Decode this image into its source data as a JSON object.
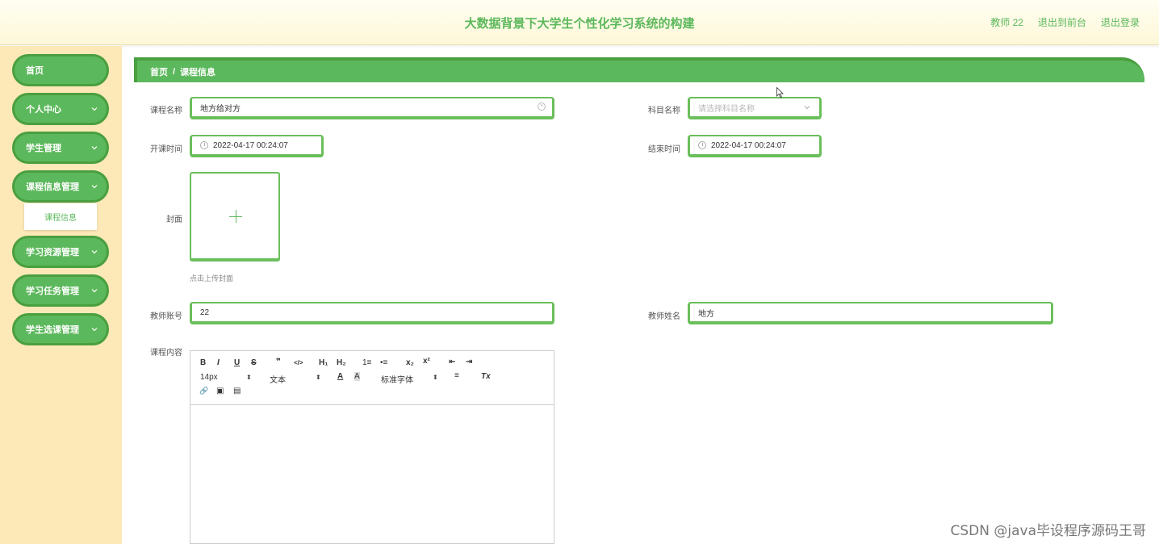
{
  "header": {
    "title": "大数据背景下大学生个性化学习系统的构建",
    "user": "教师 22",
    "back_to_front": "退出到前台",
    "logout": "退出登录"
  },
  "sidebar": {
    "items": [
      {
        "label": "首页",
        "has_children": false
      },
      {
        "label": "个人中心",
        "has_children": true
      },
      {
        "label": "学生管理",
        "has_children": true
      },
      {
        "label": "课程信息管理",
        "has_children": true
      },
      {
        "label": "学习资源管理",
        "has_children": true
      },
      {
        "label": "学习任务管理",
        "has_children": true
      },
      {
        "label": "学生选课管理",
        "has_children": true
      }
    ],
    "submenu_label": "课程信息"
  },
  "breadcrumb": {
    "home": "首页",
    "separator": "/",
    "current": "课程信息"
  },
  "form": {
    "course_name_label": "课程名称",
    "course_name_value": "地方给对方",
    "subject_label": "科目名称",
    "subject_placeholder": "请选择科目名称",
    "start_label": "开课时间",
    "start_value": "2022-04-17 00:24:07",
    "end_label": "结束时间",
    "end_value": "2022-04-17 00:24:07",
    "cover_label": "封面",
    "cover_hint": "点击上传封面",
    "teacher_account_label": "教师账号",
    "teacher_account_value": "22",
    "teacher_name_label": "教师姓名",
    "teacher_name_value": "地方",
    "content_label": "课程内容"
  },
  "editor": {
    "bold": "B",
    "italic": "I",
    "underline": "U",
    "strike": "S",
    "quote": "❞",
    "code": "</>",
    "h1": "H₁",
    "h2": "H₂",
    "ordered": "1≡",
    "bullet": "•≡",
    "subscript": "x₂",
    "superscript": "x²",
    "outdent": "⇤",
    "indent": "⇥",
    "font_size": "14px",
    "block_type": "文本",
    "font_color": "A",
    "bg_color": "A",
    "font_family": "标准字体",
    "align": "≡",
    "clear": "Tx",
    "link": "🔗",
    "image": "▣",
    "video": "▤"
  },
  "watermark": "CSDN @java毕设程序源码王哥",
  "colors": {
    "accent": "#5cb85c",
    "accent_dark": "#4a9f3f",
    "sidebar_bg": "#fde9b8",
    "header_bg": "#fdf7d8"
  }
}
